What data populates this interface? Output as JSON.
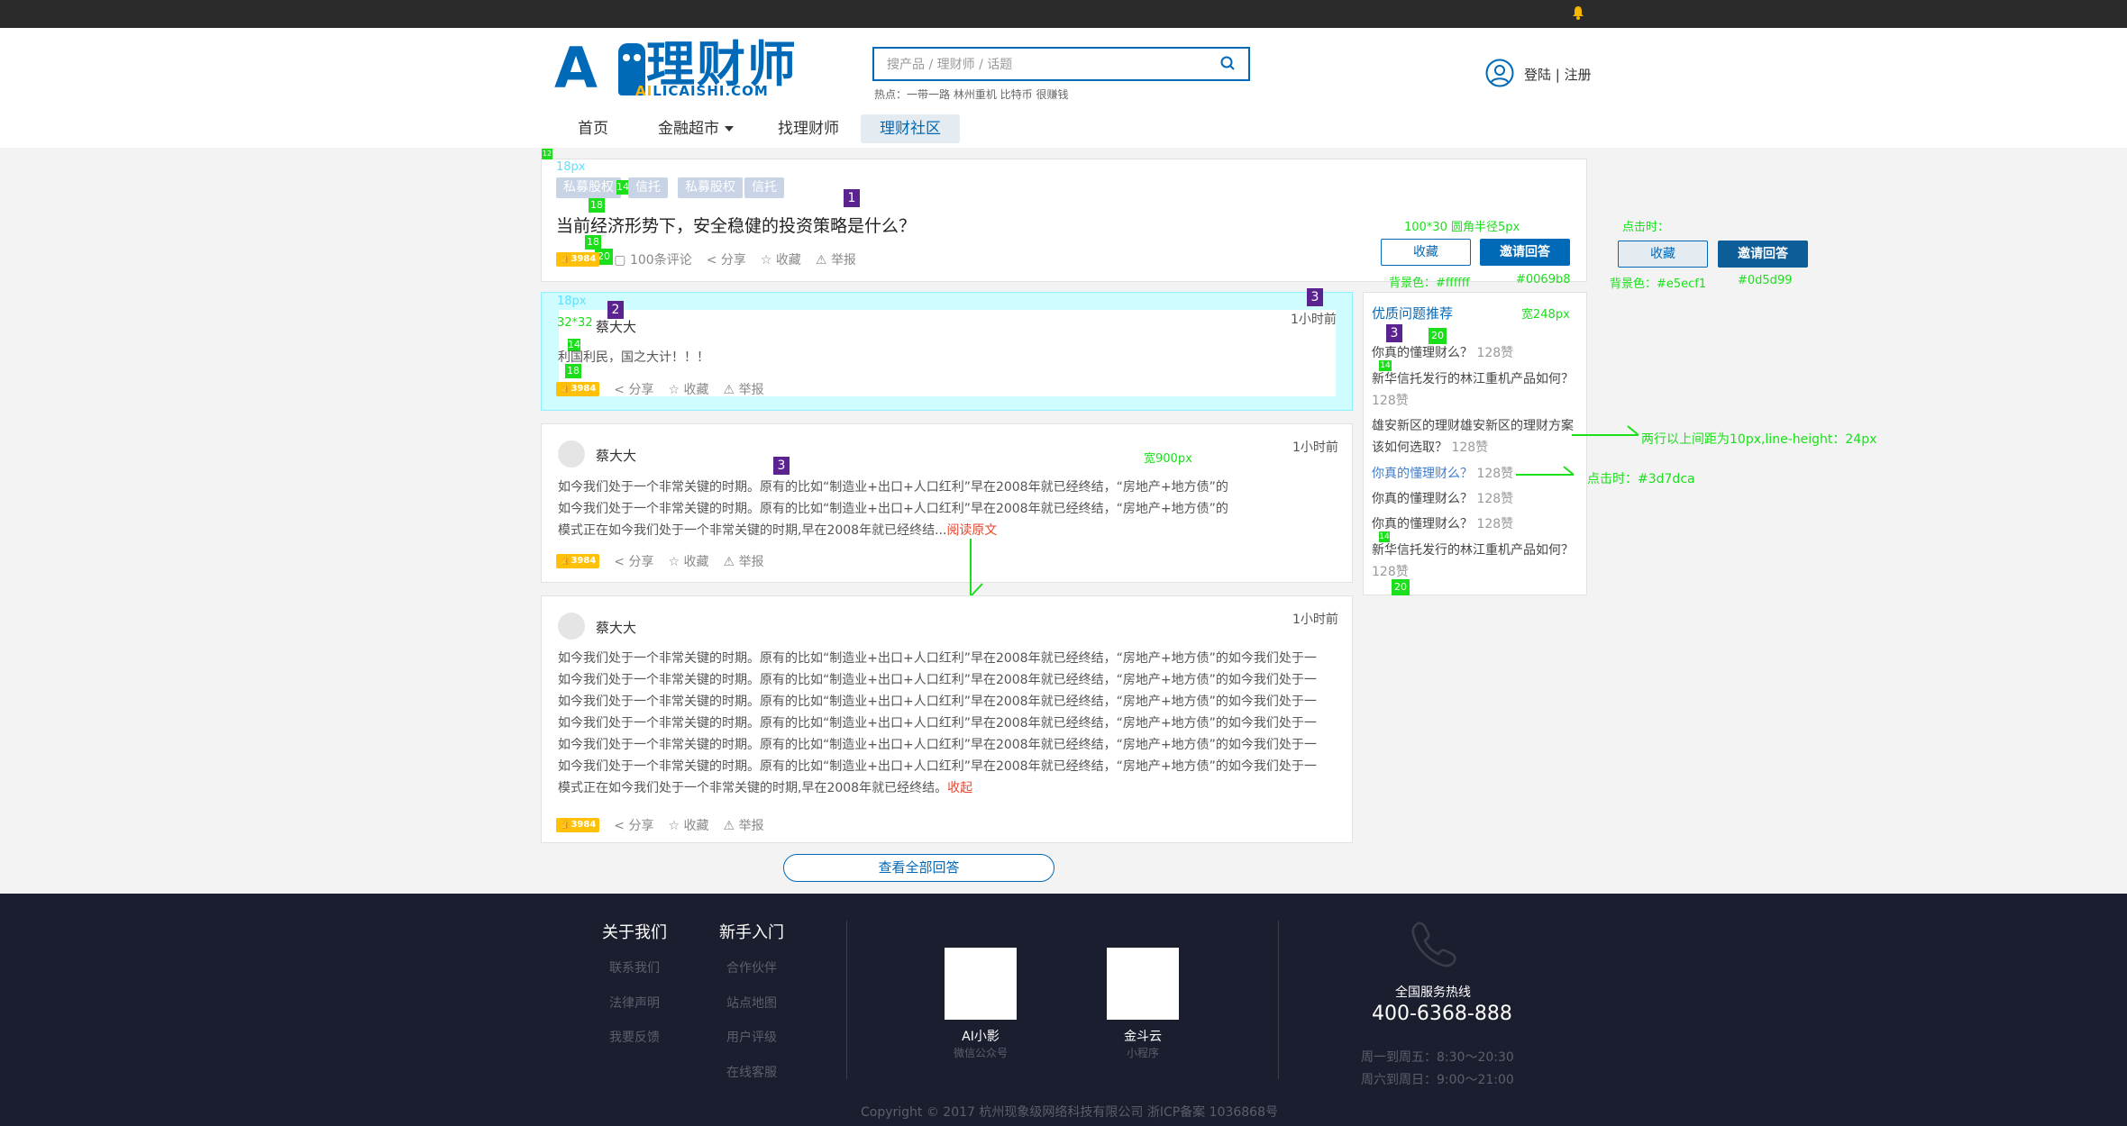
{
  "header": {
    "logo_cn": "理财师",
    "logo_en_prefix": "AI",
    "logo_en_suffix": "LICAISHI.COM",
    "search_placeholder": "搜产品 / 理财师 / 话题",
    "hot": "热点：一带一路 林州重机 比特币 很赚钱",
    "login": "登陆 | 注册"
  },
  "nav": {
    "items": [
      "首页",
      "金融超市",
      "找理财师",
      "理财社区"
    ],
    "active": "理财社区"
  },
  "question": {
    "tags": [
      "私募股权",
      "信托",
      "私募股权",
      "信托"
    ],
    "title": "当前经济形势下，安全稳健的投资策略是什么？",
    "likes": "3984",
    "comments": "100条评论",
    "share": "分享",
    "favorite": "收藏",
    "report": "举报",
    "btn_favorite": "收藏",
    "btn_invite": "邀请回答"
  },
  "annotations": {
    "btn_spec": "100*30 圆角半径5px",
    "on_click": "点击时：",
    "bg_white": "背景色：#ffffff",
    "bg_blue": "#0069b8",
    "bg_click": "背景色：#e5ecf1",
    "bg_click_blue": "#0d5d99",
    "px18": "18px",
    "px18b": "18px",
    "avatar_spec": "32*32",
    "width900": "宽900px",
    "width248": "宽248px",
    "line_height": "两行以上间距为10px,line-height：24px",
    "hover_color": "点击时：#3d7dca",
    "n1": "1",
    "n2": "2",
    "n3": "3",
    "g12": "12",
    "g14": "14",
    "g18": "18",
    "g20": "20"
  },
  "answers": [
    {
      "user": "蔡大大",
      "time": "1小时前",
      "text": "利国利民，国之大计！！！",
      "likes": "3984"
    },
    {
      "user": "蔡大大",
      "time": "1小时前",
      "lines": [
        "如今我们处于一个非常关键的时期。原有的比如“制造业+出口+人口红利”早在2008年就已经终结，“房地产+地方债”的",
        "如今我们处于一个非常关键的时期。原有的比如“制造业+出口+人口红利”早在2008年就已经终结，“房地产+地方债”的",
        "模式正在如今我们处于一个非常关键的时期,早在2008年就已经终结..."
      ],
      "read_more": "阅读原文",
      "likes": "3984"
    },
    {
      "user": "蔡大大",
      "time": "1小时前",
      "lines": [
        "如今我们处于一个非常关键的时期。原有的比如“制造业+出口+人口红利”早在2008年就已经终结，“房地产+地方债”的如今我们处于一",
        "如今我们处于一个非常关键的时期。原有的比如“制造业+出口+人口红利”早在2008年就已经终结，“房地产+地方债”的如今我们处于一",
        "如今我们处于一个非常关键的时期。原有的比如“制造业+出口+人口红利”早在2008年就已经终结，“房地产+地方债”的如今我们处于一",
        "如今我们处于一个非常关键的时期。原有的比如“制造业+出口+人口红利”早在2008年就已经终结，“房地产+地方债”的如今我们处于一",
        "如今我们处于一个非常关键的时期。原有的比如“制造业+出口+人口红利”早在2008年就已经终结，“房地产+地方债”的如今我们处于一",
        "如今我们处于一个非常关键的时期。原有的比如“制造业+出口+人口红利”早在2008年就已经终结，“房地产+地方债”的如今我们处于一",
        "模式正在如今我们处于一个非常关键的时期,早在2008年就已经终结。"
      ],
      "collapse": "收起",
      "likes": "3984"
    }
  ],
  "view_all": "查看全部回答",
  "sidebar": {
    "title": "优质问题推荐",
    "items": [
      {
        "q": "你真的懂理财么？",
        "cnt": "128赞"
      },
      {
        "q": "新华信托发行的林江重机产品如何？",
        "cnt": "128赞"
      },
      {
        "q": "雄安新区的理财雄安新区的理财方案该如何选取？",
        "cnt": "128赞"
      },
      {
        "q": "你真的懂理财么？",
        "cnt": "128赞"
      },
      {
        "q": "你真的懂理财么？",
        "cnt": "128赞"
      },
      {
        "q": "你真的懂理财么？",
        "cnt": "128赞"
      },
      {
        "q": "新华信托发行的林江重机产品如何？",
        "cnt": "128赞"
      }
    ]
  },
  "footer": {
    "col1_title": "关于我们",
    "col1": [
      "联系我们",
      "法律声明",
      "我要反馈"
    ],
    "col2_title": "新手入门",
    "col2": [
      "合作伙伴",
      "站点地图",
      "用户评级",
      "在线客服"
    ],
    "qr1_title": "AI小影",
    "qr1_sub": "微信公众号",
    "qr2_title": "金斗云",
    "qr2_sub": "小程序",
    "hotline_label": "全国服务热线",
    "hotline": "400-6368-888",
    "hours1": "周一到周五：8:30～20:30",
    "hours2": "周六到周日：9:00～21:00",
    "copyright": "Copyright © 2017 杭州现象级网络科技有限公司 浙ICP备案 1036868号"
  },
  "colors": {
    "primary": "#0069b8",
    "hover": "#3d7dca",
    "click_bg": "#e5ecf1",
    "click_primary": "#0d5d99"
  }
}
